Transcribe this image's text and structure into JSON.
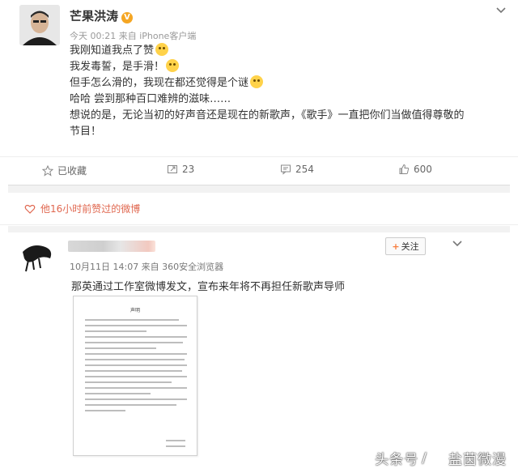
{
  "post1": {
    "author": "芒果洪涛",
    "verified_badge": "V",
    "meta": "今天 00:21 来自 iPhone客户端",
    "lines": [
      "我刚知道我点了赞",
      "我发毒誓，是手滑！",
      "但手怎么滑的，我现在都还觉得是个谜",
      "哈哈 尝到那种百口难辨的滋味……",
      "想说的是，无论当初的好声音还是现在的新歌声，《歌手》一直把你们当做值得尊敬的节目！"
    ],
    "actions": {
      "favorite": "已收藏",
      "repost": "23",
      "comment": "254",
      "like": "600"
    }
  },
  "liked_notice": "他16小时前赞过的微博",
  "post2": {
    "follow_label": "关注",
    "meta": "10月11日 14:07 来自 360安全浏览器",
    "text": "那英通过工作室微博发文，宣布来年将不再担任新歌声导师",
    "doc_title": "声明"
  },
  "watermark": {
    "platform": "头条号",
    "separator": "/",
    "account": "盐茵微漫"
  },
  "colors": {
    "accent_orange": "#f77c3d",
    "liked_red": "#e0674f",
    "verified_gold": "#f5a623"
  },
  "icons": [
    "chevron-down-icon",
    "star-icon",
    "repost-icon",
    "comment-icon",
    "thumbs-up-icon",
    "heart-icon",
    "plus-icon",
    "eye-icon",
    "emoji-icon"
  ]
}
